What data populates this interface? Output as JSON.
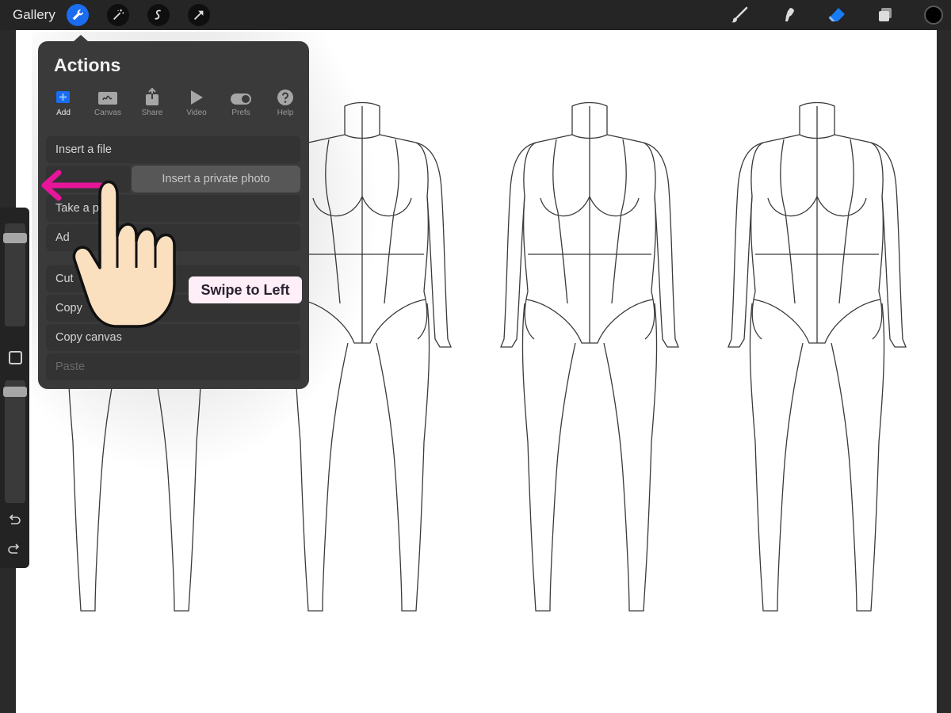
{
  "topbar": {
    "gallery_label": "Gallery",
    "left_tools": [
      "wrench-icon",
      "magic-wand-icon",
      "selection-icon",
      "transform-arrow-icon"
    ],
    "right_tools": [
      "brush-icon",
      "smudge-icon",
      "eraser-icon",
      "layers-icon"
    ],
    "accent_color": "#1a6cf0",
    "current_color": "#000000"
  },
  "actions_panel": {
    "title": "Actions",
    "tabs": [
      {
        "label": "Add",
        "icon": "add-image-icon",
        "active": true
      },
      {
        "label": "Canvas",
        "icon": "canvas-icon",
        "active": false
      },
      {
        "label": "Share",
        "icon": "share-icon",
        "active": false
      },
      {
        "label": "Video",
        "icon": "play-icon",
        "active": false
      },
      {
        "label": "Prefs",
        "icon": "toggle-icon",
        "active": false
      },
      {
        "label": "Help",
        "icon": "help-icon",
        "active": false
      }
    ],
    "rows": {
      "insert_file": "Insert a file",
      "insert_private_photo": "Insert a private photo",
      "take_photo": "Take a p",
      "add_text": "Ad",
      "cut": "Cut",
      "copy": "Copy",
      "copy_canvas": "Copy canvas",
      "paste": "Paste"
    }
  },
  "overlay": {
    "instruction": "Swipe to Left",
    "arrow_color": "#e6159a"
  }
}
